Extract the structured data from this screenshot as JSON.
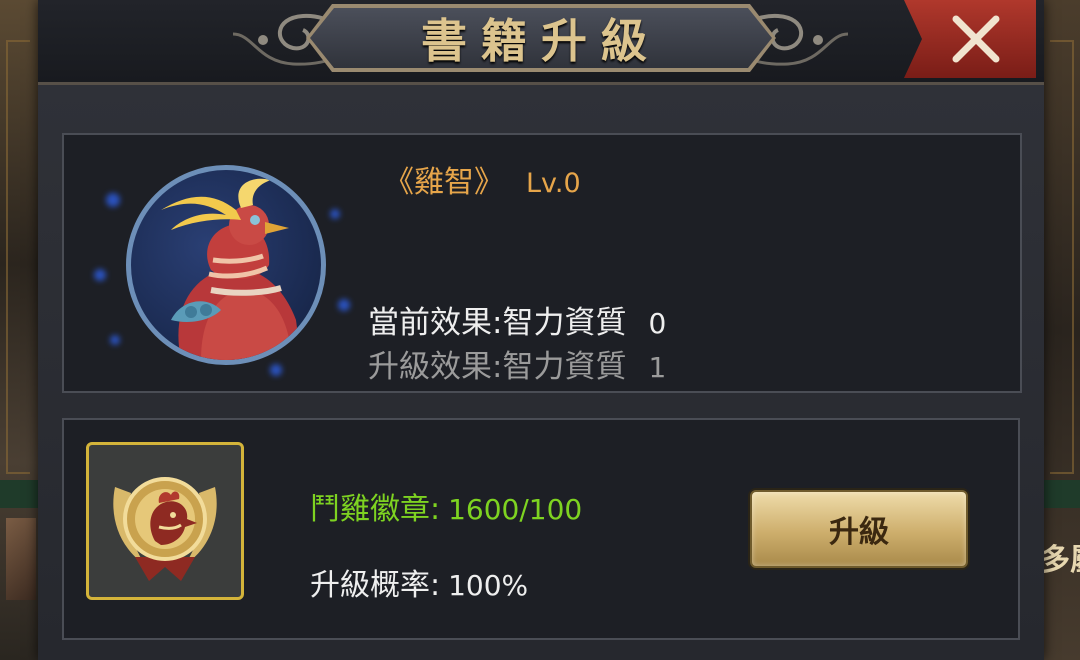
{
  "dialog": {
    "title": "書籍升級",
    "close_icon": "close-x-icon"
  },
  "book": {
    "name": "《雞智》",
    "level": "Lv.0",
    "portrait_icon": "golden-pheasant-portrait"
  },
  "effects": {
    "current_label": "當前效果:",
    "current_attr": "智力資質",
    "current_value": "0",
    "next_label": "升級效果:",
    "next_attr": "智力資質",
    "next_value": "1"
  },
  "upgrade": {
    "material_icon": "rooster-badge-icon",
    "material_label": "鬥雞徽章:",
    "material_amount": "1600/100",
    "rate_label": "升級概率:",
    "rate_value": "100%",
    "button_label": "升級"
  },
  "background": {
    "right_edge_text": "多屬"
  },
  "colors": {
    "title_gold": "#dcc48e",
    "book_name_orange": "#e6a54a",
    "material_green": "#7ed321",
    "close_red": "#b0382c",
    "frame_gold": "#d4b43a"
  }
}
